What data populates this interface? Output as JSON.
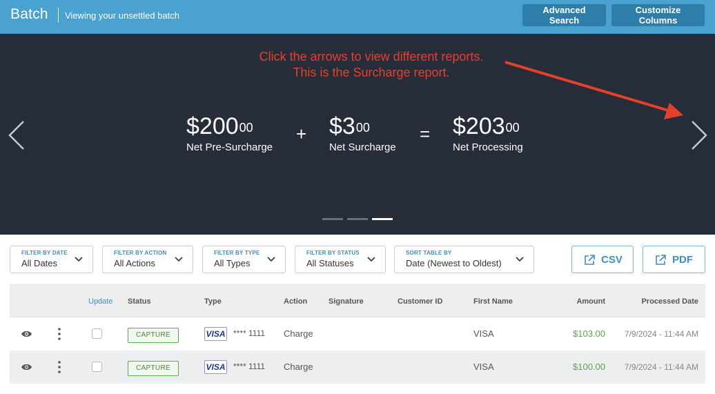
{
  "header": {
    "brand": "Batch",
    "subtitle": "Viewing your unsettled batch",
    "advanced_search": "Advanced Search",
    "customize_columns": "Customize Columns"
  },
  "banner": {
    "annotation_line1": "Click the arrows to view different reports.",
    "annotation_line2": "This is the Surcharge report.",
    "metrics": [
      {
        "whole": "$200",
        "cents": "00",
        "label": "Net Pre-Surcharge"
      },
      {
        "whole": "$3",
        "cents": "00",
        "label": "Net Surcharge"
      },
      {
        "whole": "$203",
        "cents": "00",
        "label": "Net Processing"
      }
    ],
    "op_plus": "+",
    "op_equals": "=",
    "active_slide": 3,
    "slide_count": 3
  },
  "filters": [
    {
      "label": "FILTER BY DATE",
      "value": "All Dates"
    },
    {
      "label": "FILTER BY ACTION",
      "value": "All Actions"
    },
    {
      "label": "FILTER BY TYPE",
      "value": "All Types"
    },
    {
      "label": "FILTER BY STATUS",
      "value": "All Statuses"
    },
    {
      "label": "SORT TABLE BY",
      "value": "Date (Newest to Oldest)"
    }
  ],
  "exports": {
    "csv": "CSV",
    "pdf": "PDF"
  },
  "table": {
    "headers": {
      "update": "Update",
      "status": "Status",
      "type": "Type",
      "action": "Action",
      "signature": "Signature",
      "customer_id": "Customer ID",
      "first_name": "First Name",
      "amount": "Amount",
      "processed_date": "Processed Date"
    },
    "rows": [
      {
        "status": "CAPTURE",
        "card_brand": "VISA",
        "last4": "**** 1111",
        "action": "Charge",
        "first_name": "VISA",
        "amount": "$103.00",
        "processed_date": "7/9/2024 - 11:44 AM"
      },
      {
        "status": "CAPTURE",
        "card_brand": "VISA",
        "last4": "**** 1111",
        "action": "Charge",
        "first_name": "VISA",
        "amount": "$100.00",
        "processed_date": "7/9/2024 - 11:44 AM"
      }
    ]
  },
  "colors": {
    "header_bg": "#4aa2d1",
    "banner_bg": "#262d39",
    "annotation": "#e4412b",
    "accent": "#3b8fc2",
    "amount_green": "#5aa54a"
  }
}
